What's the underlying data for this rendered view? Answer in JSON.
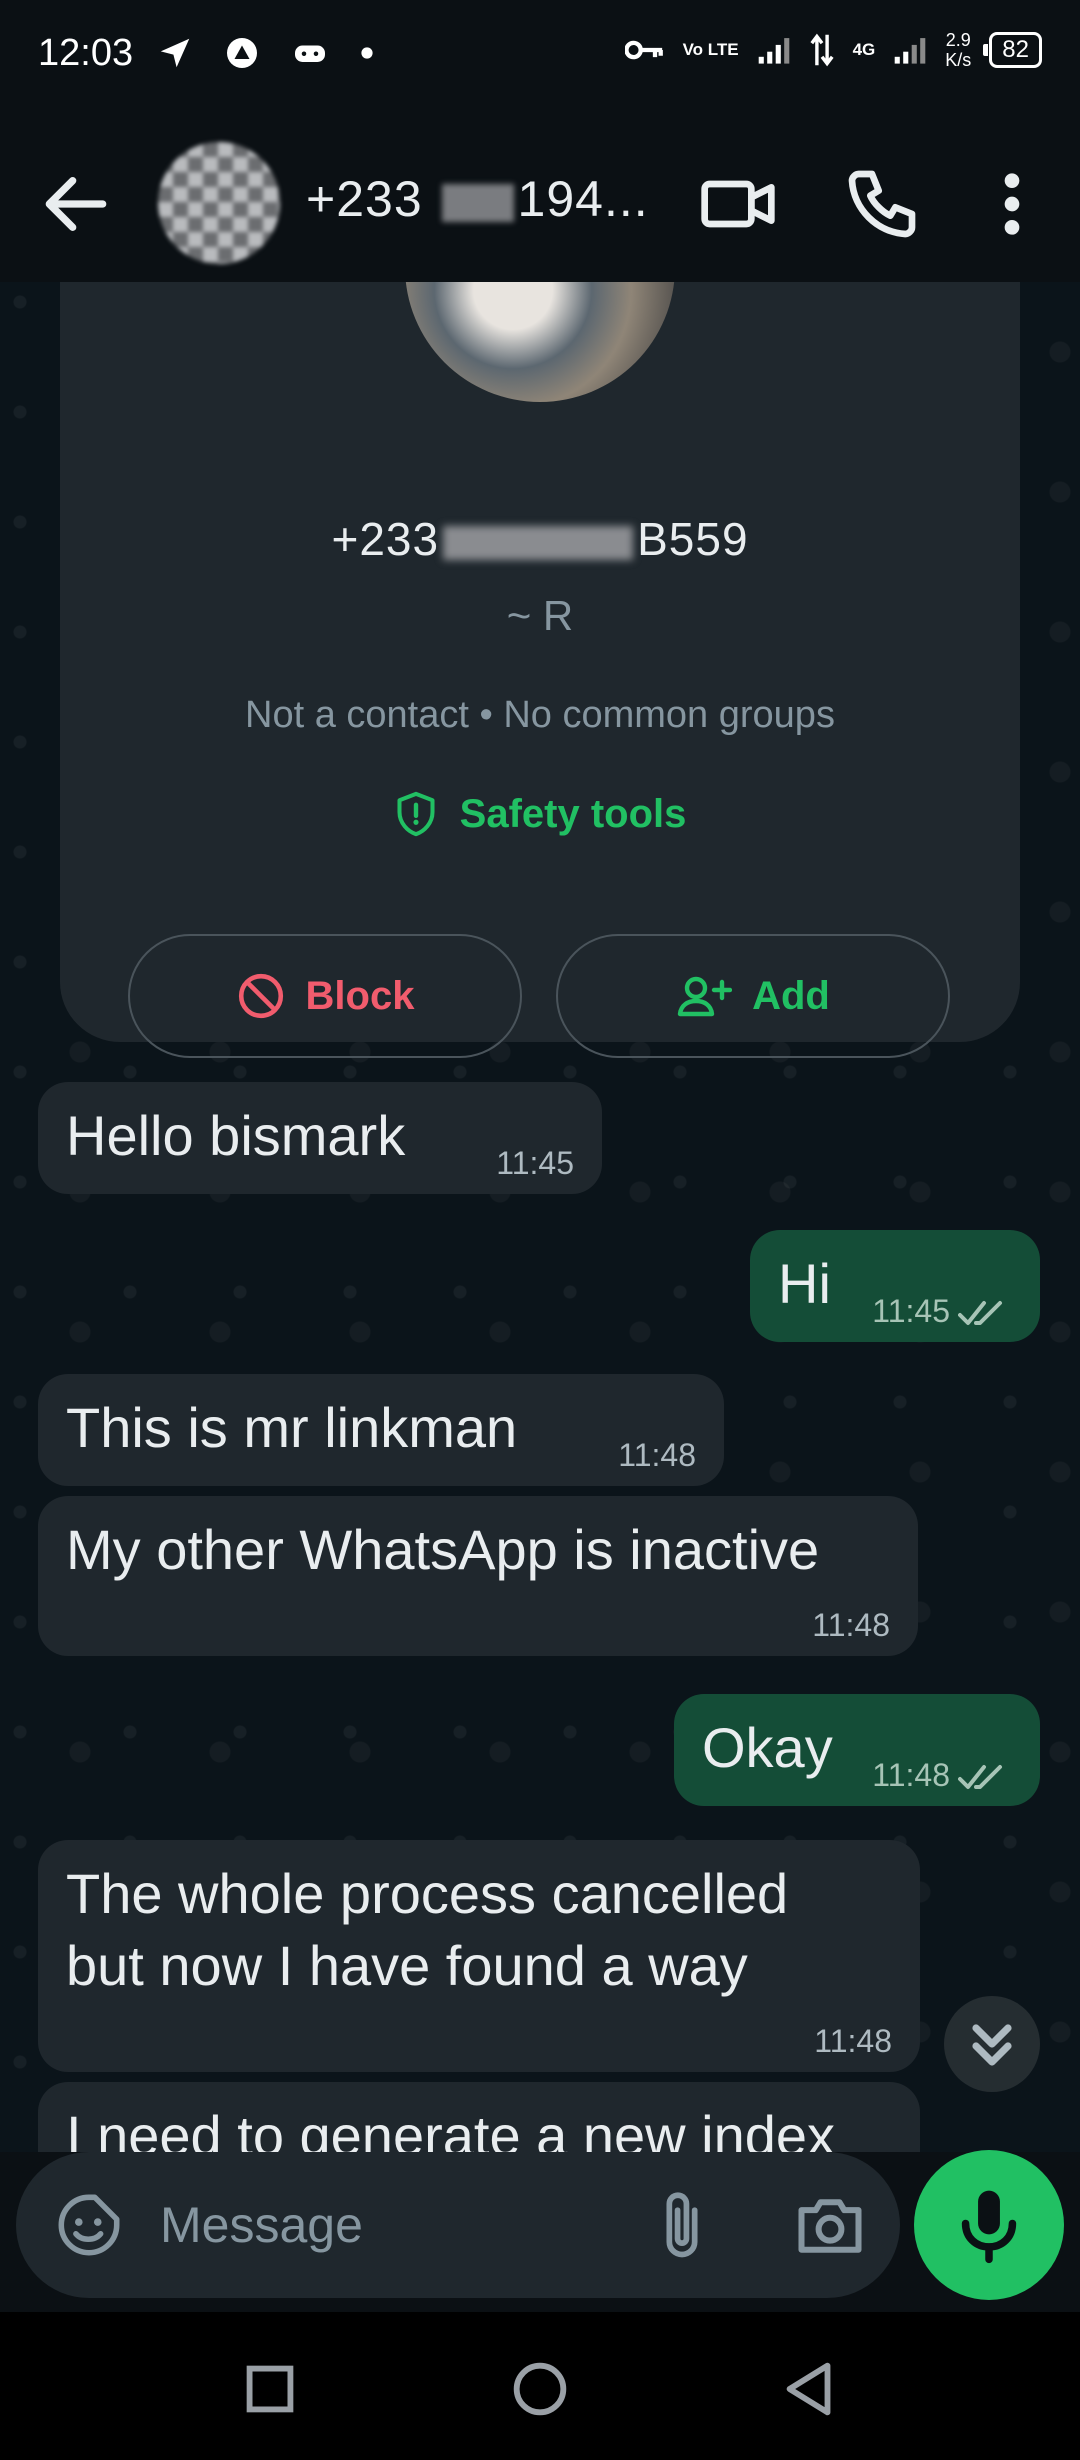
{
  "status_bar": {
    "time": "12:03",
    "network_label": "Vo LTE",
    "data_type": "4G",
    "speed_value": "2.9",
    "speed_unit": "K/s",
    "battery": "82"
  },
  "header": {
    "title_prefix": "+233",
    "title_suffix": "194..."
  },
  "info_card": {
    "number_prefix": "+233",
    "number_suffix": "B559",
    "name": "~ R",
    "meta": "Not a contact • No common groups",
    "safety_label": "Safety tools",
    "block_label": "Block",
    "add_label": "Add"
  },
  "messages": [
    {
      "direction": "in",
      "text": "Hello bismark",
      "time": "11:45"
    },
    {
      "direction": "out",
      "text": "Hi",
      "time": "11:45",
      "read": true
    },
    {
      "direction": "in",
      "text": "This is mr linkman",
      "time": "11:48"
    },
    {
      "direction": "in",
      "text": "My other WhatsApp is inactive",
      "time": "11:48"
    },
    {
      "direction": "out",
      "text": "Okay",
      "time": "11:48",
      "read": true
    },
    {
      "direction": "in",
      "text": "The whole process cancelled but now I have found a way",
      "time": "11:48"
    },
    {
      "direction": "in",
      "text": "I need to generate a new index",
      "time": ""
    }
  ],
  "composer": {
    "placeholder": "Message"
  },
  "colors": {
    "accent": "#21c063",
    "danger": "#f15c6d",
    "outgoing_bubble": "#144d37",
    "incoming_bubble": "#1f272d",
    "chat_background": "#0b141a"
  }
}
